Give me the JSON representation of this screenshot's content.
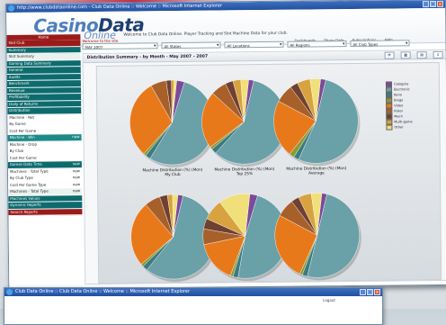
{
  "window": {
    "title": "http://www.clubdataonline.com - Club Data Online :: Welcome :: Microsoft Internet Explorer",
    "logout": "Logout",
    "min": "_",
    "max": "□",
    "close": "×"
  },
  "brand": {
    "name_a": "Casino",
    "name_b": "Data",
    "tag": "Online"
  },
  "header": {
    "welcome": "Welcome to Club Data Online. Player Tracking and Slot Machine Data for your club.",
    "links": [
      "Dashboards",
      "Share Data",
      "Subscriptions",
      "Help"
    ]
  },
  "sidebar": {
    "head": "Home",
    "subhead": "Welcome to the site",
    "items": [
      {
        "label": "Slot Club",
        "style": "red",
        "tag": ""
      },
      {
        "label": "Summary",
        "style": "",
        "tag": ""
      },
      {
        "label": "Slot Summary",
        "style": "lightg",
        "tag": ""
      },
      {
        "label": "Gaming Data Summary",
        "style": "",
        "tag": ""
      },
      {
        "label": "General",
        "style": "",
        "tag": ""
      },
      {
        "label": "Audits",
        "style": "",
        "tag": ""
      },
      {
        "label": "Benchmark",
        "style": "",
        "tag": ""
      },
      {
        "label": "Revenue",
        "style": "",
        "tag": ""
      },
      {
        "label": "Profitability",
        "style": "",
        "tag": ""
      },
      {
        "label": "Daily of Returns",
        "style": "",
        "tag": ""
      },
      {
        "label": "Distribution",
        "style": "",
        "tag": ""
      },
      {
        "label": "Machine - Net",
        "style": "light",
        "tag": ""
      },
      {
        "label": "By Game",
        "style": "light",
        "tag": ""
      },
      {
        "label": "Cost Per Game",
        "style": "light",
        "tag": ""
      },
      {
        "label": "Machine - Win",
        "style": "sel",
        "tag": "new"
      },
      {
        "label": "Machine - Drop",
        "style": "light",
        "tag": ""
      },
      {
        "label": "By Club",
        "style": "light",
        "tag": ""
      },
      {
        "label": "Cost Per Game",
        "style": "light",
        "tag": ""
      },
      {
        "label": "Games Data Time",
        "style": "",
        "tag": "new"
      },
      {
        "label": "Machines - Total Type",
        "style": "light",
        "tag": "new"
      },
      {
        "label": "By Club Type",
        "style": "light",
        "tag": "new"
      },
      {
        "label": "Cost Per Game Type",
        "style": "light",
        "tag": "new"
      },
      {
        "label": "Machines - Total Type",
        "style": "lightg",
        "tag": "new"
      },
      {
        "label": "Machines Values",
        "style": "",
        "tag": ""
      },
      {
        "label": "Dynamic Reports",
        "style": "",
        "tag": ""
      },
      {
        "label": "Search Reports",
        "style": "red",
        "tag": ""
      }
    ]
  },
  "filters": [
    {
      "value": "MAY 2007",
      "width": 84
    },
    {
      "value": "All States",
      "width": 66
    },
    {
      "value": "All Locations",
      "width": 66
    },
    {
      "value": "All Regions",
      "width": 66
    },
    {
      "value": "All Club Types",
      "width": 66
    }
  ],
  "panel": {
    "title": "Distribution Summary - by Month - May 2007 - 2007",
    "tools": [
      "refresh-icon",
      "chart-icon",
      "grid-icon",
      "export-icon"
    ]
  },
  "legend": {
    "items": [
      {
        "label": "Category",
        "color": "#7b4a9a"
      },
      {
        "label": "Electronic",
        "color": "#6aa0a8"
      },
      {
        "label": "Keno",
        "color": "#3c7b7f"
      },
      {
        "label": "Bingo",
        "color": "#8a9a3a"
      },
      {
        "label": "Video",
        "color": "#e8791a"
      },
      {
        "label": "Poker",
        "color": "#a8602a"
      },
      {
        "label": "Mech",
        "color": "#704030"
      },
      {
        "label": "Multi-game",
        "color": "#d7a23f"
      },
      {
        "label": "Other",
        "color": "#f1e07a"
      }
    ]
  },
  "chart_data": {
    "type": "pie",
    "captions": [
      "Machine Distribution (%) (Mon)\nMy Club",
      "Machine Distribution (%) (Mon)\nTop 25%",
      "Machine Distribution (%) (Mon)\nAverage",
      "",
      "",
      ""
    ],
    "series": [
      {
        "values": [
          3,
          54,
          2,
          1,
          30,
          6,
          2,
          1,
          1
        ]
      },
      {
        "values": [
          2,
          58,
          2,
          1,
          22,
          6,
          3,
          3,
          3
        ]
      },
      {
        "values": [
          2,
          53,
          2,
          2,
          22,
          7,
          3,
          5,
          4
        ]
      },
      {
        "values": [
          2,
          57,
          2,
          1,
          25,
          6,
          3,
          2,
          2
        ]
      },
      {
        "values": [
          3,
          48,
          2,
          1,
          16,
          6,
          4,
          8,
          12
        ]
      },
      {
        "values": [
          2,
          50,
          2,
          1,
          26,
          7,
          3,
          5,
          4
        ]
      }
    ]
  },
  "window2": {
    "title": "Club Data Online :: Club Data Online :: Welcome :: Microsoft Internet Explorer",
    "logout": "Logout"
  }
}
